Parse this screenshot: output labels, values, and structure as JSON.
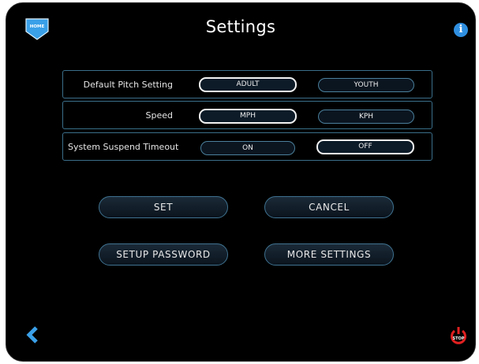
{
  "header": {
    "title": "Settings",
    "home_label": "HOME",
    "info_label": "i"
  },
  "settings": [
    {
      "label": "Default Pitch Setting",
      "options": [
        "ADULT",
        "YOUTH"
      ],
      "selected": 0
    },
    {
      "label": "Speed",
      "options": [
        "MPH",
        "KPH"
      ],
      "selected": 0
    },
    {
      "label": "System Suspend Timeout",
      "options": [
        "ON",
        "OFF"
      ],
      "selected": 1
    }
  ],
  "buttons": {
    "set": "SET",
    "cancel": "CANCEL",
    "setup_password": "SETUP PASSWORD",
    "more_settings": "MORE SETTINGS"
  },
  "footer": {
    "stop_label": "STOP"
  },
  "colors": {
    "accent_blue": "#2f8fe0",
    "stop_red": "#e02020",
    "row_border": "#3a6f8a"
  },
  "icons": {
    "home": "home-icon",
    "info": "info-icon",
    "back": "back-chevron-icon",
    "stop": "power-stop-icon"
  }
}
